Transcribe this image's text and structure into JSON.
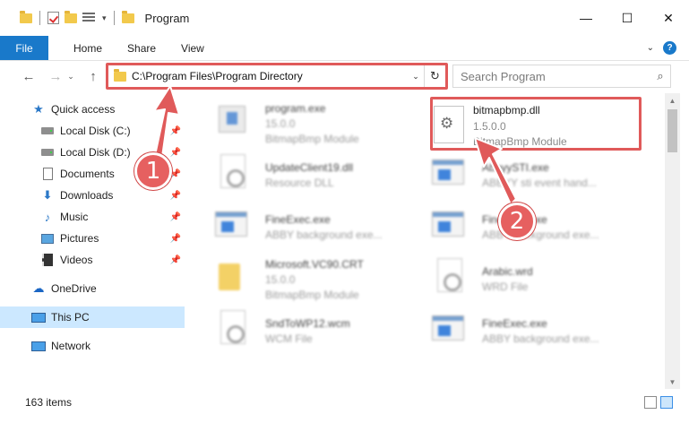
{
  "window": {
    "title": "Program",
    "minimize": "—",
    "maximize": "☐",
    "close": "✕"
  },
  "ribbon": {
    "tabs": [
      "File",
      "Home",
      "Share",
      "View"
    ],
    "collapse": "⌄",
    "help": "?"
  },
  "nav": {
    "back": "←",
    "forward": "→",
    "recent": "⌄",
    "up": "↑"
  },
  "address": {
    "path": "C:\\Program Files\\Program Directory",
    "dropdown": "⌄",
    "refresh": "↻"
  },
  "search": {
    "placeholder": "Search Program",
    "icon": "⌕"
  },
  "sidebar": {
    "items": [
      {
        "label": "Quick access",
        "icon": "star-icon",
        "pinned": false
      },
      {
        "label": "Local Disk (C:)",
        "icon": "drive-icon",
        "pinned": true
      },
      {
        "label": "Local Disk (D:)",
        "icon": "drive-icon",
        "pinned": true
      },
      {
        "label": "Documents",
        "icon": "documents-icon",
        "pinned": true
      },
      {
        "label": "Downloads",
        "icon": "download-icon",
        "pinned": true
      },
      {
        "label": "Music",
        "icon": "music-icon",
        "pinned": true
      },
      {
        "label": "Pictures",
        "icon": "pictures-icon",
        "pinned": true
      },
      {
        "label": "Videos",
        "icon": "videos-icon",
        "pinned": true
      },
      {
        "label": "OneDrive",
        "icon": "cloud-icon",
        "pinned": false
      },
      {
        "label": "This PC",
        "icon": "computer-icon",
        "pinned": false,
        "selected": true
      },
      {
        "label": "Network",
        "icon": "network-icon",
        "pinned": false
      }
    ],
    "pin_glyph": "📌"
  },
  "files": [
    {
      "name": "program.exe",
      "line2": "15.0.0",
      "line3": "BitmapBmp Module"
    },
    {
      "name": "UpdateClient19.dll",
      "line2": "Resource DLL",
      "line3": ""
    },
    {
      "name": "AbbyySTI.exe",
      "line2": "ABBYY sti event hand...",
      "line3": ""
    },
    {
      "name": "FineExec.exe",
      "line2": "ABBY background exe...",
      "line3": ""
    },
    {
      "name": "FineExec.exe",
      "line2": "ABBY background exe...",
      "line3": ""
    },
    {
      "name": "Microsoft.VC90.CRT",
      "line2": "15.0.0",
      "line3": "BitmapBmp Module"
    },
    {
      "name": "Arabic.wrd",
      "line2": "WRD File",
      "line3": ""
    },
    {
      "name": "SndToWP12.wcm",
      "line2": "WCM File",
      "line3": ""
    },
    {
      "name": "FineExec.exe",
      "line2": "ABBY background exe...",
      "line3": ""
    }
  ],
  "highlighted_file": {
    "name": "bitmapbmp.dll",
    "version": "1.5.0.0",
    "description": "BitmapBmp Module",
    "gear": "⚙"
  },
  "annotations": {
    "step1": "1",
    "step2": "2",
    "color": "#e05a5a"
  },
  "status": {
    "count": "163 items"
  }
}
